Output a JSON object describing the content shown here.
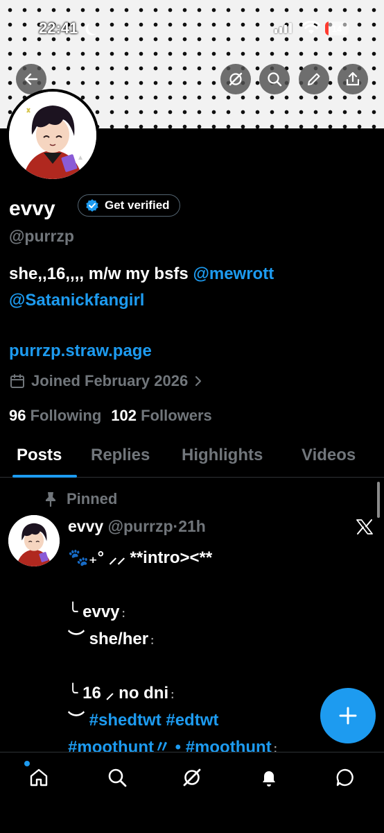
{
  "status_bar": {
    "time": "22:41",
    "battery": "14"
  },
  "header": {
    "icons": [
      "back-arrow-icon",
      "grok-icon",
      "search-icon",
      "edit-icon",
      "share-icon"
    ]
  },
  "profile": {
    "name": "evvy",
    "verify_label": "Get verified",
    "handle": "@purrzp",
    "bio_text": "she,,16,,,, m/w my bsfs ",
    "bio_mention_1": "@mewrott",
    "bio_mention_2": "@Satanickfangirl",
    "url": "purrzp.straw.page",
    "joined": "Joined February 2026",
    "following_count": "96",
    "following_label": "Following",
    "followers_count": "102",
    "followers_label": "Followers"
  },
  "tabs": [
    {
      "label": "Posts"
    },
    {
      "label": "Replies"
    },
    {
      "label": "Highlights"
    },
    {
      "label": "Videos"
    }
  ],
  "post": {
    "pinned_label": "Pinned",
    "author": "evvy",
    "handle": "@purrzp",
    "separator": "·",
    "time": "21h",
    "lines": {
      "l1_emoji": "🐾₊°  ⸝⸝ ",
      "l1_text": "**intro><**",
      "l3_mark": "╰ ",
      "l3_text": "evvy",
      "l3_dots": " ⁚",
      "l4_mark": "︶ ",
      "l4_text": "she/her",
      "l4_dots": " ⁚",
      "l6_mark": "╰ ",
      "l6_text": "16 ⸝ no dni",
      "l6_dots": " ⁚",
      "l7_mark": "︶ ",
      "l7_tags": "#shedtwt #edtwt",
      "l8_tags": "#moothunt〃 • #moothunt",
      "l8_dots": " ⁚"
    }
  },
  "colors": {
    "accent": "#1d9bf0",
    "muted": "#71767b",
    "background": "#000000"
  }
}
